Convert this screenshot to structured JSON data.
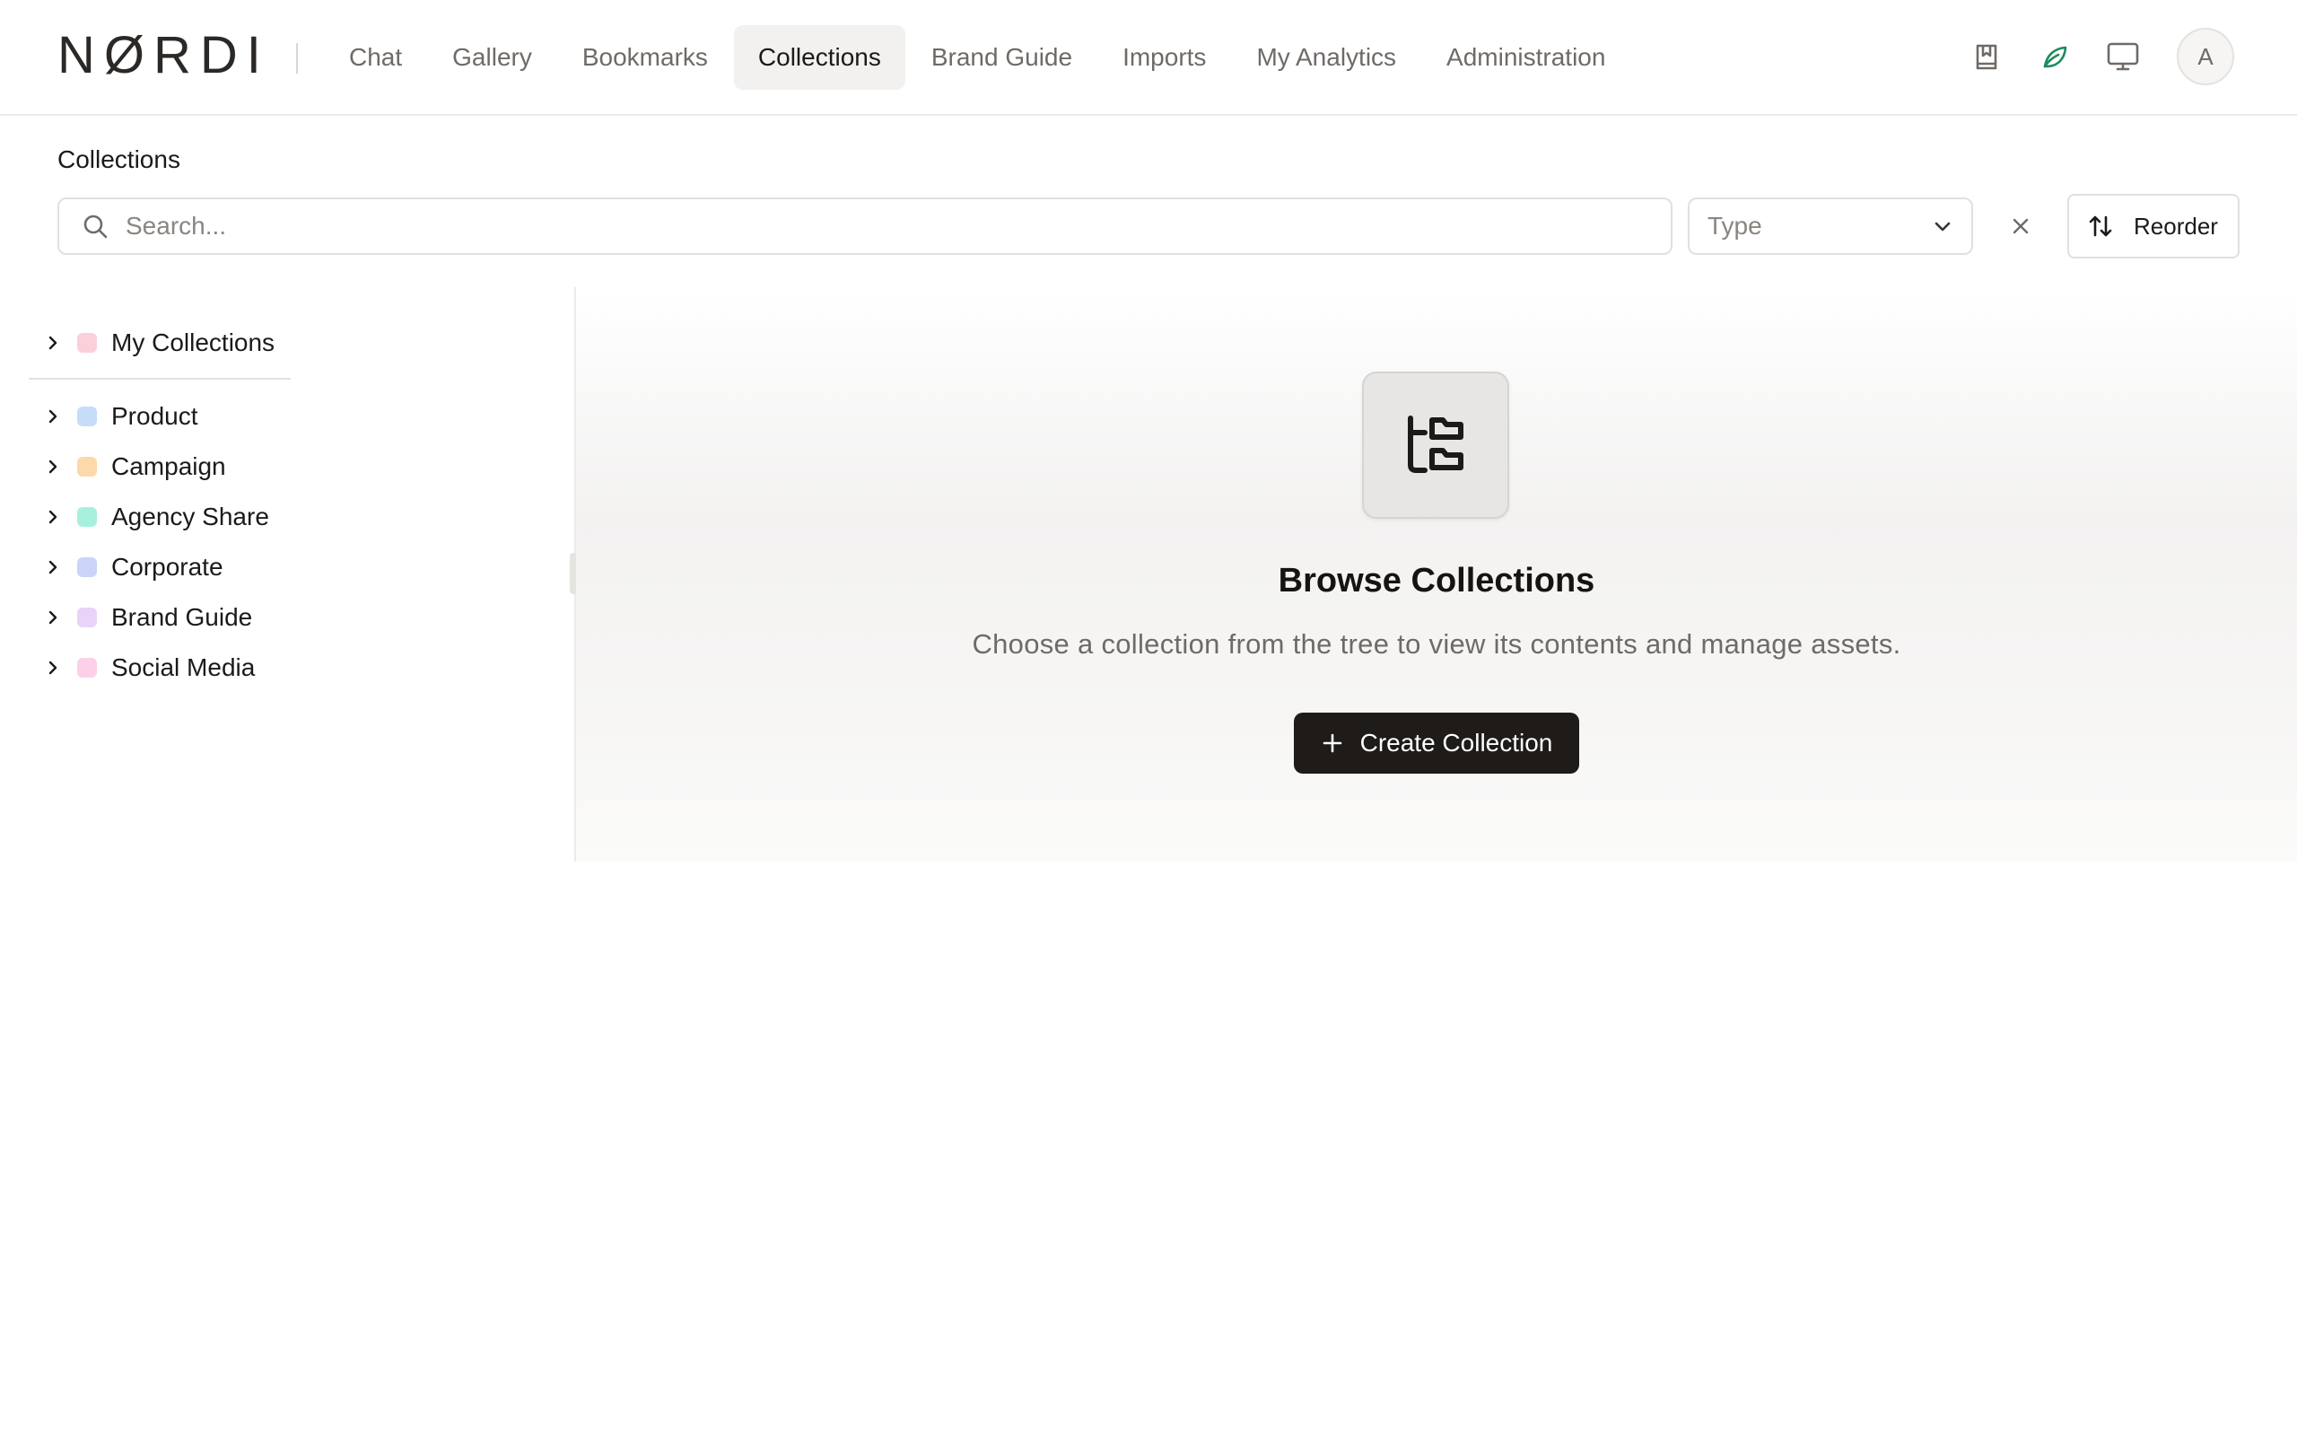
{
  "brand": {
    "logo_text": "NØRDI"
  },
  "nav": {
    "items": [
      {
        "label": "Chat"
      },
      {
        "label": "Gallery"
      },
      {
        "label": "Bookmarks"
      },
      {
        "label": "Collections",
        "active": true
      },
      {
        "label": "Brand Guide"
      },
      {
        "label": "Imports"
      },
      {
        "label": "My Analytics"
      },
      {
        "label": "Administration"
      }
    ]
  },
  "top_icons": [
    "bookmark-book-icon",
    "leaf-icon",
    "monitor-icon"
  ],
  "user": {
    "avatar_initial": "A"
  },
  "page": {
    "title": "Collections"
  },
  "filters": {
    "search_placeholder": "Search...",
    "type_placeholder": "Type",
    "reorder_label": "Reorder"
  },
  "tree": {
    "items": [
      {
        "label": "My Collections",
        "color": "#fbd0d9"
      },
      {
        "label": "Product",
        "color": "#c7dcf8"
      },
      {
        "label": "Campaign",
        "color": "#fcd9a8"
      },
      {
        "label": "Agency Share",
        "color": "#a7f0de"
      },
      {
        "label": "Corporate",
        "color": "#cbd3f8"
      },
      {
        "label": "Brand Guide",
        "color": "#e8d4f8"
      },
      {
        "label": "Social Media",
        "color": "#fbd0e8"
      }
    ]
  },
  "empty_state": {
    "icon": "folder-tree-icon",
    "title": "Browse Collections",
    "description": "Choose a collection from the tree to view its contents and manage assets.",
    "button_label": "Create Collection"
  },
  "colors": {
    "accent_green": "#1f8a5c",
    "primary_button": "#1e1b19"
  }
}
